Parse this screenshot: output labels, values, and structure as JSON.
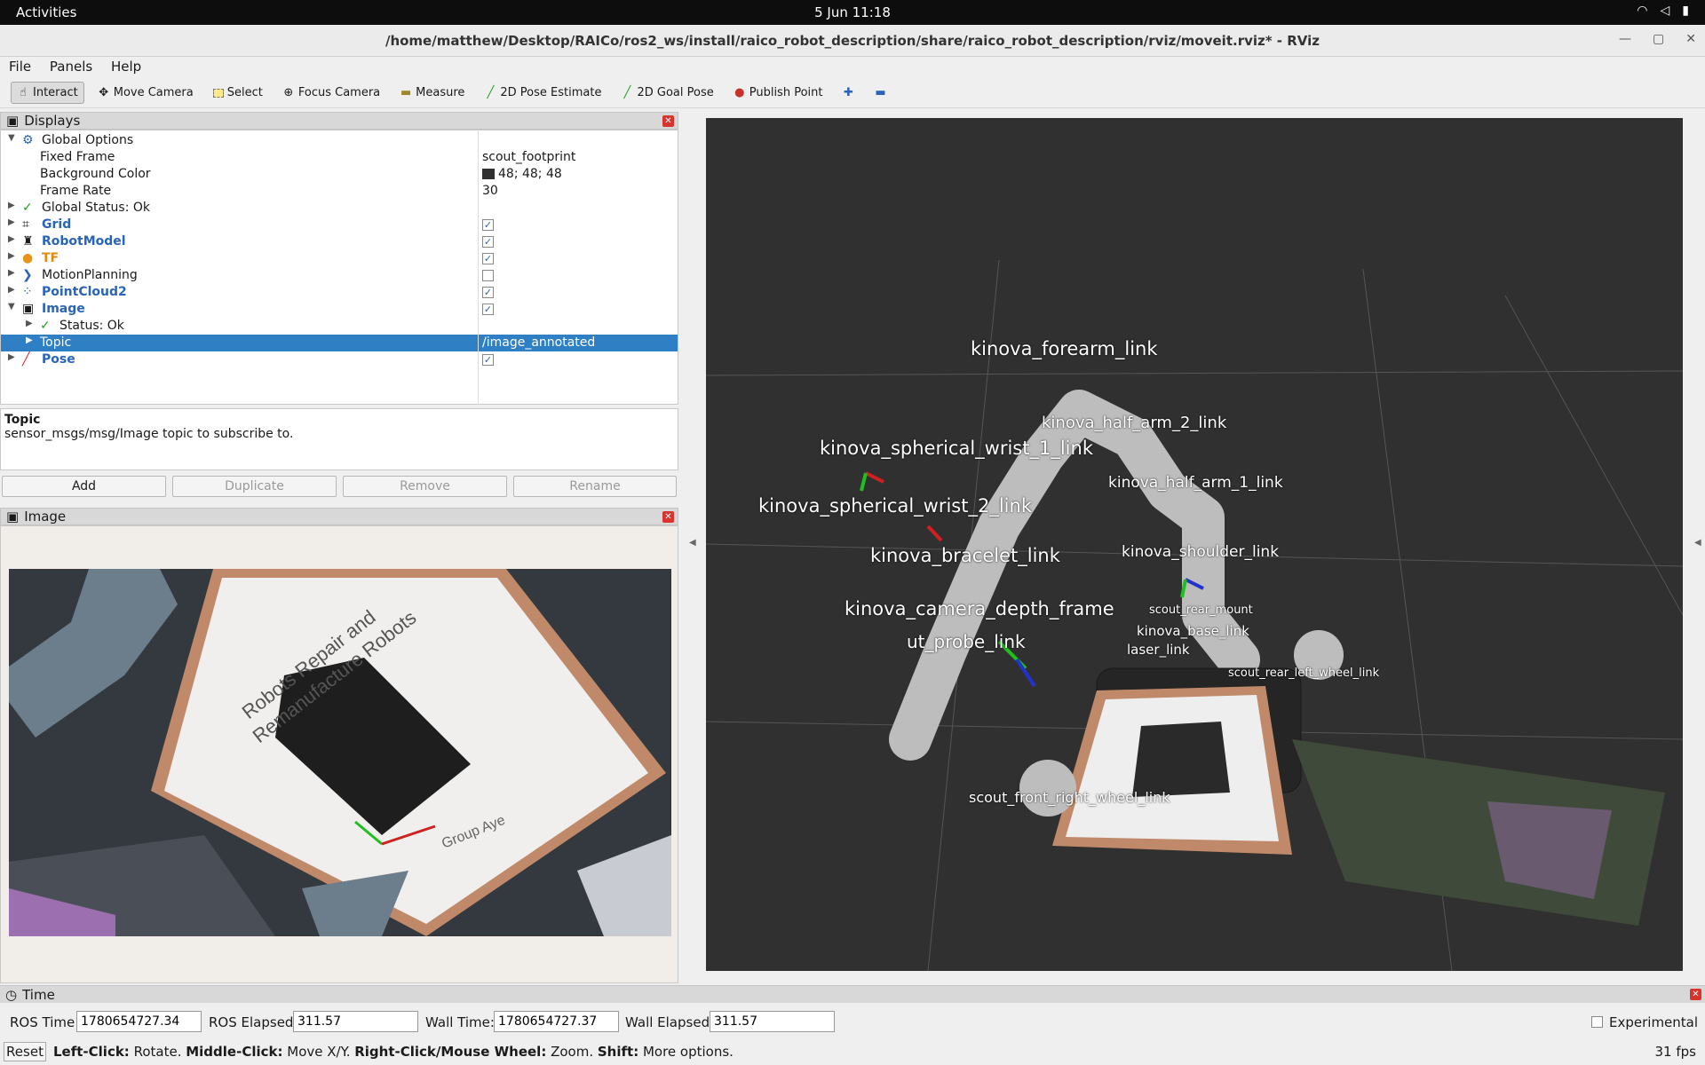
{
  "topbar": {
    "activities": "Activities",
    "clock": "5 Jun  11:18"
  },
  "window": {
    "title": "/home/matthew/Desktop/RAICo/ros2_ws/install/raico_robot_description/share/raico_robot_description/rviz/moveit.rviz* - RViz"
  },
  "menu": {
    "file": "File",
    "panels": "Panels",
    "help": "Help"
  },
  "toolbar": {
    "interact": "Interact",
    "move_camera": "Move Camera",
    "select": "Select",
    "focus_camera": "Focus Camera",
    "measure": "Measure",
    "pose_estimate": "2D Pose Estimate",
    "goal_pose": "2D Goal Pose",
    "publish_point": "Publish Point"
  },
  "displays": {
    "title": "Displays",
    "global_options": "Global Options",
    "fixed_frame_label": "Fixed Frame",
    "fixed_frame_value": "scout_footprint",
    "bg_color_label": "Background Color",
    "bg_color_value": "48; 48; 48",
    "frame_rate_label": "Frame Rate",
    "frame_rate_value": "30",
    "global_status": "Global Status: Ok",
    "grid": "Grid",
    "robot_model": "RobotModel",
    "tf": "TF",
    "motion_planning": "MotionPlanning",
    "pointcloud": "PointCloud2",
    "image": "Image",
    "status_ok": "Status: Ok",
    "topic_label": "Topic",
    "topic_value": "/image_annotated",
    "pose": "Pose"
  },
  "description": {
    "title": "Topic",
    "text": "sensor_msgs/msg/Image topic to subscribe to."
  },
  "buttons": {
    "add": "Add",
    "duplicate": "Duplicate",
    "remove": "Remove",
    "rename": "Rename"
  },
  "image_panel": {
    "title": "Image",
    "board_text_1": "Robots Repair and",
    "board_text_2": "Remanufacture Robots",
    "board_text_3": "Group Aye"
  },
  "viewport_labels": {
    "forearm": "kinova_forearm_link",
    "half_arm_2": "kinova_half_arm_2_link",
    "wrist_1": "kinova_spherical_wrist_1_link",
    "half_arm_1": "kinova_half_arm_1_link",
    "wrist_2": "kinova_spherical_wrist_2_link",
    "shoulder": "kinova_shoulder_link",
    "bracelet": "kinova_bracelet_link",
    "camera_depth": "kinova_camera_depth_frame",
    "base_link": "kinova_base_link",
    "rear_mount": "scout_rear_mount",
    "laser_link": "laser_link",
    "probe": "ut_probe_link",
    "rear_left_wheel": "scout_rear_left_wheel_link",
    "front_right_wheel": "scout_front_right_wheel_link"
  },
  "time": {
    "title": "Time",
    "ros_time_label": "ROS Time:",
    "ros_time": "1780654727.34",
    "ros_elapsed_label": "ROS Elapsed:",
    "ros_elapsed": "311.57",
    "wall_time_label": "Wall Time:",
    "wall_time": "1780654727.37",
    "wall_elapsed_label": "Wall Elapsed:",
    "wall_elapsed": "311.57",
    "experimental": "Experimental"
  },
  "status": {
    "reset": "Reset",
    "left_click": "Left-Click:",
    "left_click_action": " Rotate. ",
    "middle_click": "Middle-Click:",
    "middle_click_action": " Move X/Y. ",
    "right_click": "Right-Click/Mouse Wheel:",
    "right_click_action": " Zoom. ",
    "shift": "Shift:",
    "shift_action": " More options.",
    "fps": "31 fps"
  }
}
